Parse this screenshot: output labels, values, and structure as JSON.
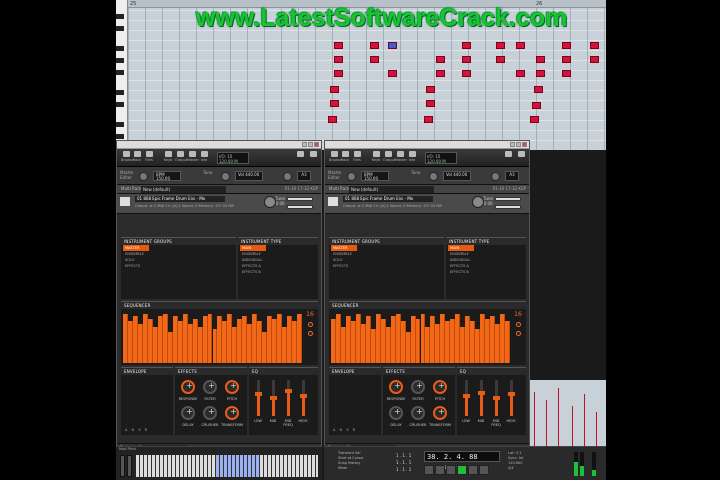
{
  "watermark": "www.LatestSoftwareCrack.com",
  "piano_roll": {
    "ruler_marks": [
      "25",
      "26"
    ]
  },
  "windows": [
    {
      "toolbar": {
        "buttons": [
          "Browse",
          "Rack",
          "Files",
          "Keyb",
          "Output",
          "Master",
          "Info"
        ],
        "readout_top": "I/O: 10",
        "readout_bottom": "120.00 M",
        "bpm_label": "BPM",
        "bpm_value": "150.00",
        "vol_label": "Vol",
        "vol_value": "440.00",
        "master_label": "Master Editor",
        "tune_label": "Tune",
        "key": "A3"
      },
      "rack": {
        "label": "Multi Rack",
        "preset": "New (default)",
        "range": "01-16",
        "aux": "17-32 KSP"
      },
      "instrument": {
        "name": "01 808 Epic Frame Drum Ens - Mo",
        "meta": "Output: st.1  Midi Ch: [A] 1  Voices: 0  Memory: 157.93 MB",
        "tune_label": "Tune",
        "tune_value": "0.00"
      },
      "groups": {
        "header": "INSTRUMENT GROUPS",
        "items": [
          "MASTER",
          "ENSEMBLE",
          "SOLO",
          "EFFECTS"
        ],
        "active": "MASTER"
      },
      "type": {
        "header": "INSTRUMENT TYPE",
        "items": [
          "MAIN",
          "ENSEMBLE",
          "INDIVIDUAL",
          "EFFECTS A",
          "EFFECTS B"
        ],
        "active": "MAIN"
      },
      "sequencer": {
        "header": "SEQUENCER",
        "steps": "16",
        "values": [
          0.95,
          0.8,
          0.9,
          0.75,
          0.95,
          0.85,
          0.7,
          0.9,
          0.95,
          0.6,
          0.9,
          0.8,
          0.95,
          0.75,
          0.85,
          0.7,
          0.9,
          0.95,
          0.65,
          0.9,
          0.8,
          0.95,
          0.7,
          0.85,
          0.9,
          0.75,
          0.95,
          0.8,
          0.6,
          0.9,
          0.85,
          0.95,
          0.7,
          0.9,
          0.8,
          0.95
        ]
      },
      "envelope": {
        "header": "ENVELOPE",
        "letters": "A D S R"
      },
      "effects": {
        "header": "EFFECTS",
        "knobs": [
          "RESPONSE",
          "FILTER",
          "PITCH",
          "DELAY",
          "CRUSHER",
          "TRANSFORM"
        ]
      },
      "eq": {
        "header": "EQ",
        "bands": [
          "LOW",
          "MID",
          "MID FREQ",
          "HIGH"
        ],
        "levels": [
          0.6,
          0.5,
          0.7,
          0.55
        ]
      },
      "footer": {
        "label": "Fan",
        "value": "Clean"
      }
    },
    {
      "toolbar": {
        "buttons": [
          "Browse",
          "Rack",
          "Files",
          "Keyb",
          "Output",
          "Master",
          "Info"
        ],
        "readout_top": "I/O: 10",
        "readout_bottom": "120.00 M",
        "bpm_label": "BPM",
        "bpm_value": "150.00",
        "vol_label": "Vol",
        "vol_value": "440.00",
        "master_label": "Master Editor",
        "tune_label": "Tune",
        "key": "A3"
      },
      "rack": {
        "label": "Multi Rack",
        "preset": "New (default)",
        "range": "01-16",
        "aux": "17-32 KSP"
      },
      "instrument": {
        "name": "01 808 Epic Frame Drum Ens - Mo",
        "meta": "Output: st.1  Midi Ch: [A] 1  Voices: 0  Memory: 157.93 MB",
        "tune_label": "Tune",
        "tune_value": "0.00"
      },
      "groups": {
        "header": "INSTRUMENT GROUPS",
        "items": [
          "MASTER",
          "ENSEMBLE",
          "SOLO",
          "EFFECTS"
        ],
        "active": "MASTER"
      },
      "type": {
        "header": "INSTRUMENT TYPE",
        "items": [
          "MAIN",
          "ENSEMBLE",
          "INDIVIDUAL",
          "EFFECTS A",
          "EFFECTS B"
        ],
        "active": "MAIN"
      },
      "sequencer": {
        "header": "SEQUENCER",
        "steps": "16",
        "values": [
          0.85,
          0.95,
          0.7,
          0.9,
          0.8,
          0.95,
          0.75,
          0.9,
          0.65,
          0.95,
          0.85,
          0.7,
          0.9,
          0.95,
          0.8,
          0.6,
          0.9,
          0.85,
          0.95,
          0.7,
          0.9,
          0.75,
          0.95,
          0.8,
          0.85,
          0.95,
          0.7,
          0.9,
          0.8,
          0.65,
          0.95,
          0.85,
          0.9,
          0.75,
          0.95,
          0.8
        ]
      },
      "envelope": {
        "header": "ENVELOPE",
        "letters": "A D S R"
      },
      "effects": {
        "header": "EFFECTS",
        "knobs": [
          "RESPONSE",
          "FILTER",
          "PITCH",
          "DELAY",
          "CRUSHER",
          "TRANSFORM"
        ]
      },
      "eq": {
        "header": "EQ",
        "bands": [
          "LOW",
          "MID",
          "MID FREQ",
          "HIGH"
        ],
        "levels": [
          0.55,
          0.65,
          0.5,
          0.6
        ]
      },
      "footer": {
        "label": "Fan",
        "value": "Clean"
      }
    }
  ],
  "keyboard": {
    "label": "Mod  Pitch"
  },
  "transport": {
    "menu": [
      "Transient Sel",
      "Start at Cursor",
      "Snap History",
      "Mixer"
    ],
    "values": [
      "1 . 1 . 1",
      "1 . 1 . 1",
      "1 . 1 . 1",
      "0"
    ],
    "position": "38. 2. 4. 88",
    "time": "0:00:10.312",
    "info": [
      "Lat: 3.1",
      "Sync: Int",
      "110.000",
      "4/4"
    ]
  },
  "colors": {
    "accent": "#f06818",
    "note": "#d0143a",
    "watermark": "#1ec12e"
  }
}
